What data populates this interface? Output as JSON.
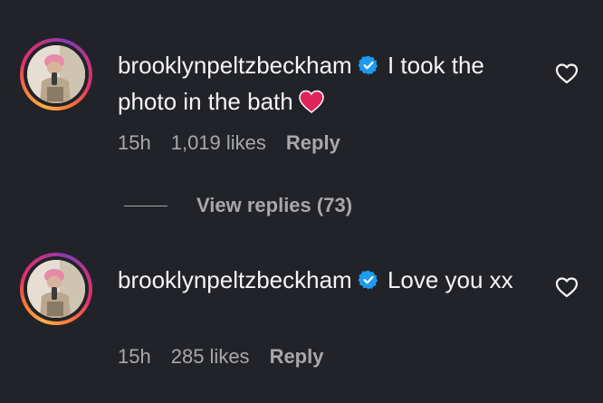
{
  "comments": [
    {
      "username": "brooklynpeltzbeckham",
      "text": "I took the photo in the bath",
      "emoji": "heart",
      "time": "15h",
      "likes": "1,019 likes",
      "reply_label": "Reply"
    },
    {
      "username": "brooklynpeltzbeckham",
      "text": "Love you xx",
      "time": "15h",
      "likes": "285 likes",
      "reply_label": "Reply"
    }
  ],
  "view_replies": "View replies (73)",
  "colors": {
    "background": "#212328",
    "text": "#f5f5f5",
    "secondary": "#a8a8a8",
    "verified": "#1d9bf0",
    "heart_emoji": "#e0245e"
  },
  "icons": [
    "verified-badge-icon",
    "heart-emoji-icon",
    "like-heart-icon",
    "avatar"
  ]
}
